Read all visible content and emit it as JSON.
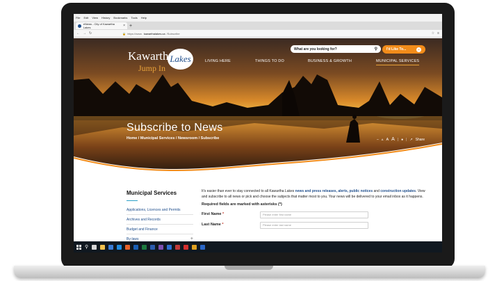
{
  "browser": {
    "menu": [
      "File",
      "Edit",
      "View",
      "History",
      "Bookmarks",
      "Tools",
      "Help"
    ],
    "tab_title": "eNews - City of Kawartha Lakes",
    "tab_close": "×",
    "new_tab": "+",
    "url_prefix": "https://www.",
    "url_host": "kawarthalakes.ca",
    "url_path": "/Subscribe"
  },
  "site": {
    "logo_word": "Kawartha",
    "logo_badge": "Lakes",
    "logo_tagline": "Jump In",
    "search_placeholder": "What are you looking for?",
    "like_to_label": "I'd Like To...",
    "nav": [
      "LIVING HERE",
      "THINGS TO DO",
      "BUSINESS & GROWTH",
      "MUNICIPAL SERVICES"
    ],
    "page_title": "Subscribe to News",
    "breadcrumb": "Home / Municipal Services / Newsroom / Subscribe",
    "tools": {
      "font_small": "A",
      "font_medium": "A",
      "font_large": "A",
      "share": "Share"
    }
  },
  "sidebar": {
    "title": "Municipal Services",
    "items": [
      {
        "label": "Applications, Licences and Permits",
        "expand": ""
      },
      {
        "label": "Archives and Records",
        "expand": ""
      },
      {
        "label": "Budget and Finance",
        "expand": ""
      },
      {
        "label": "By-laws",
        "expand": "+"
      }
    ]
  },
  "main": {
    "intro_1": "It's easier than ever to stay connected to all Kawartha Lakes ",
    "link_1": "news and press releases, alerts, public notices",
    "intro_2": " and ",
    "link_2": "construction updates",
    "intro_3": ". View and subscribe to all news or pick and choose the subjects that matter most to you. Your news will be delivered to your email inbox as it happens.",
    "required_note": "Required fields are marked with asterisks (*)",
    "fields": [
      {
        "label": "First Name",
        "star": "*",
        "placeholder": "Please enter first name"
      },
      {
        "label": "Last Name",
        "star": "*",
        "placeholder": "Please enter last name"
      }
    ]
  },
  "colors": {
    "accent_orange": "#f28c1a",
    "link_blue": "#1f4e8c",
    "rule_teal": "#2aa0c7"
  }
}
